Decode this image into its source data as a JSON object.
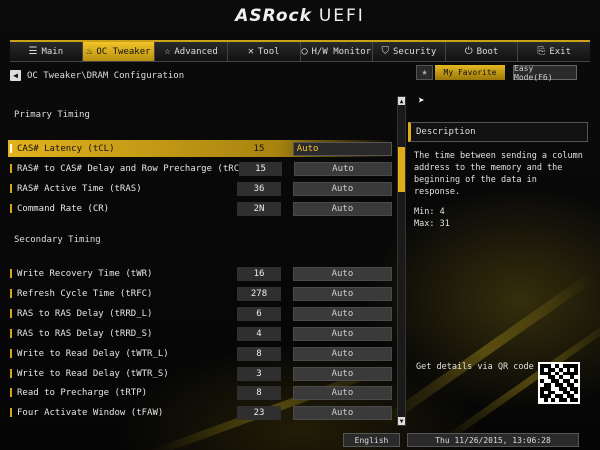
{
  "header": {
    "brand": "ASRock",
    "product": "UEFI"
  },
  "nav": {
    "tabs": [
      {
        "label": "Main",
        "icon": "list-icon"
      },
      {
        "label": "OC Tweaker",
        "icon": "flame-icon"
      },
      {
        "label": "Advanced",
        "icon": "star-icon"
      },
      {
        "label": "Tool",
        "icon": "wrench-icon"
      },
      {
        "label": "H/W Monitor",
        "icon": "monitor-icon"
      },
      {
        "label": "Security",
        "icon": "shield-icon"
      },
      {
        "label": "Boot",
        "icon": "power-icon"
      },
      {
        "label": "Exit",
        "icon": "exit-icon"
      }
    ],
    "active_tab": "OC Tweaker"
  },
  "breadcrumb": "OC Tweaker\\DRAM Configuration",
  "toolbar": {
    "favorite_label": "My Favorite",
    "easy_mode_label": "Easy Mode(F6)"
  },
  "sections": {
    "primary": "Primary Timing",
    "secondary": "Secondary Timing"
  },
  "primary_rows": [
    {
      "label": "CAS# Latency (tCL)",
      "value": "15",
      "option": "Auto"
    },
    {
      "label": "RAS# to CAS# Delay and Row Precharge (tRCDtRP)",
      "value": "15",
      "option": "Auto"
    },
    {
      "label": "RAS# Active Time (tRAS)",
      "value": "36",
      "option": "Auto"
    },
    {
      "label": "Command Rate (CR)",
      "value": "2N",
      "option": "Auto"
    }
  ],
  "secondary_rows": [
    {
      "label": "Write Recovery Time (tWR)",
      "value": "16",
      "option": "Auto"
    },
    {
      "label": "Refresh Cycle Time (tRFC)",
      "value": "278",
      "option": "Auto"
    },
    {
      "label": "RAS to RAS Delay (tRRD_L)",
      "value": "6",
      "option": "Auto"
    },
    {
      "label": "RAS to RAS Delay (tRRD_S)",
      "value": "4",
      "option": "Auto"
    },
    {
      "label": "Write to Read Delay (tWTR_L)",
      "value": "8",
      "option": "Auto"
    },
    {
      "label": "Write to Read Delay (tWTR_S)",
      "value": "3",
      "option": "Auto"
    },
    {
      "label": "Read to Precharge (tRTP)",
      "value": "8",
      "option": "Auto"
    },
    {
      "label": "Four Activate Window (tFAW)",
      "value": "23",
      "option": "Auto"
    }
  ],
  "description": {
    "title": "Description",
    "text": "The time between sending a column address to the memory and the beginning of the data in response.",
    "min": "Min: 4",
    "max": "Max: 31",
    "qr_label": "Get details via QR code"
  },
  "footer": {
    "language": "English",
    "datetime": "Thu 11/26/2015, 13:06:28"
  },
  "colors": {
    "accent": "#e0ad18",
    "background": "#050505"
  }
}
